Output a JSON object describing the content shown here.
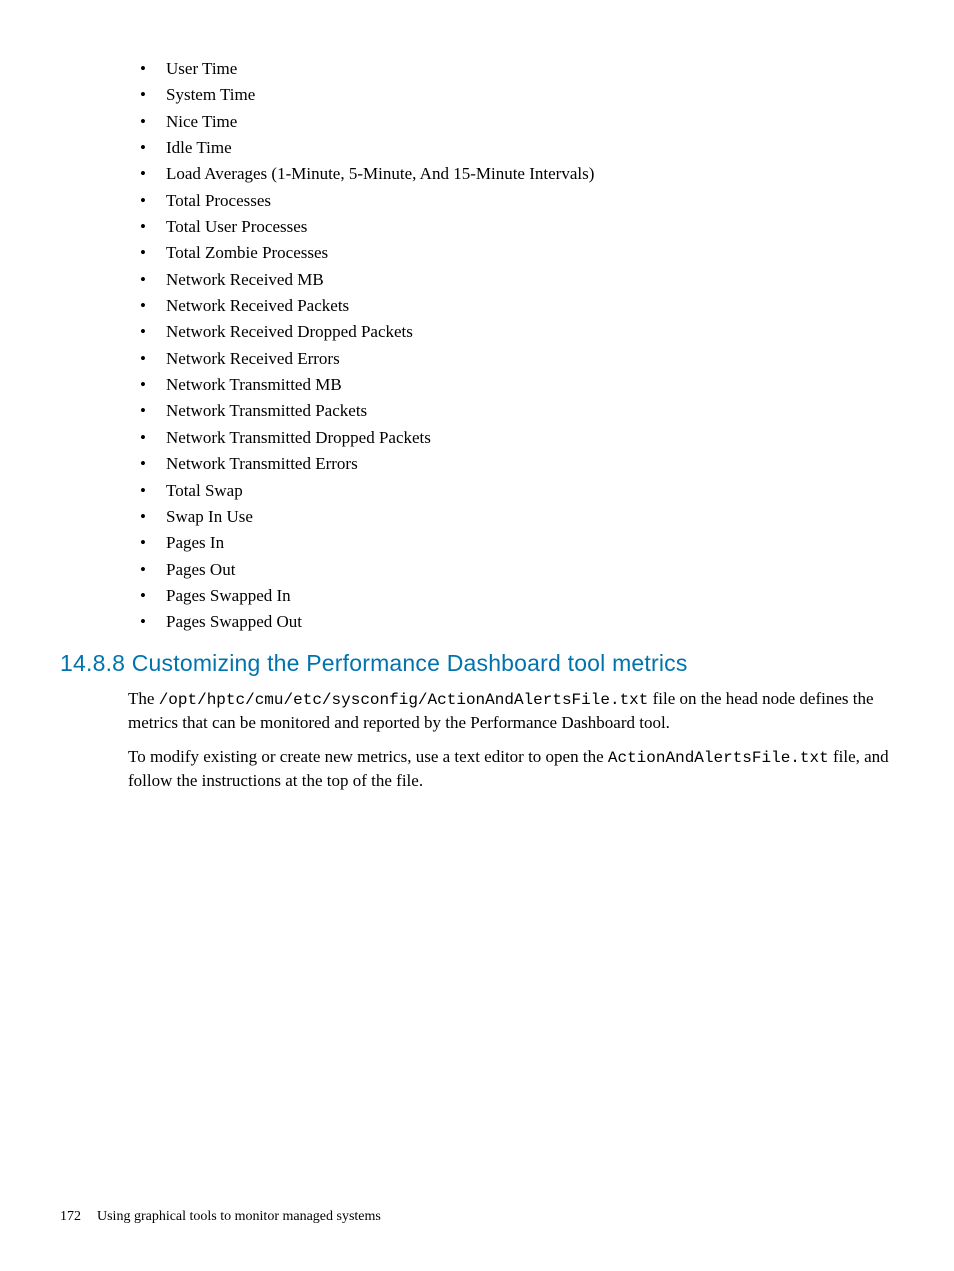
{
  "metrics": [
    "User Time",
    "System Time",
    "Nice Time",
    "Idle Time",
    "Load Averages (1-Minute, 5-Minute, And 15-Minute Intervals)",
    "Total Processes",
    "Total User Processes",
    "Total Zombie Processes",
    "Network Received MB",
    "Network Received Packets",
    "Network Received Dropped Packets",
    "Network Received Errors",
    "Network Transmitted MB",
    "Network Transmitted Packets",
    "Network Transmitted Dropped Packets",
    "Network Transmitted Errors",
    "Total Swap",
    "Swap In Use",
    "Pages In",
    "Pages Out",
    "Pages Swapped In",
    "Pages Swapped Out"
  ],
  "section": {
    "heading": "14.8.8 Customizing the Performance Dashboard tool metrics",
    "para1_pre": "The ",
    "para1_code": "/opt/hptc/cmu/etc/sysconfig/ActionAndAlertsFile.txt",
    "para1_post": " file on the head node defines the metrics that can be monitored and reported by the Performance Dashboard tool.",
    "para2_pre": "To modify existing or create new metrics, use a text editor to open the ",
    "para2_code": "ActionAndAlertsFile.txt",
    "para2_post": " file, and follow the instructions at the top of the file."
  },
  "footer": {
    "page": "172",
    "title": "Using graphical tools to monitor managed systems"
  }
}
